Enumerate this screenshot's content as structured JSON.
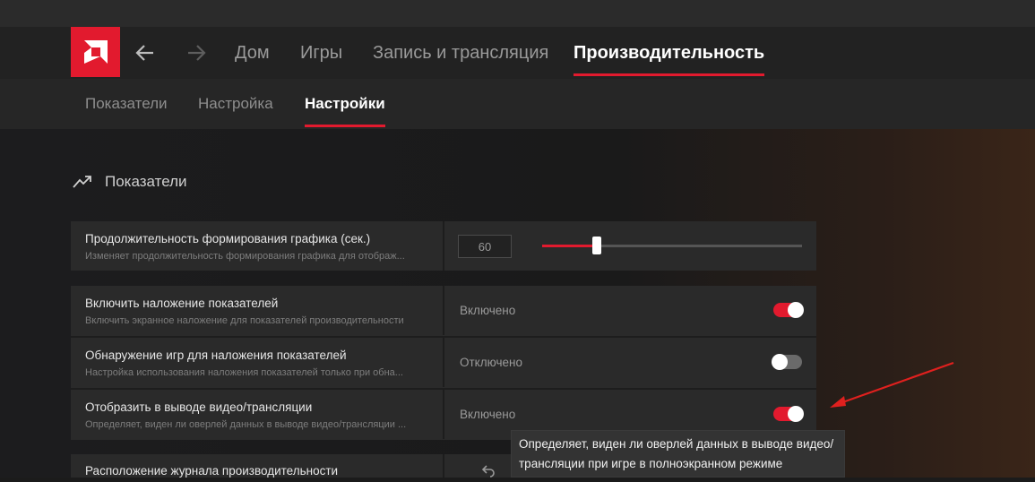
{
  "header": {
    "nav_tabs": [
      {
        "label": "Дом"
      },
      {
        "label": "Игры"
      },
      {
        "label": "Запись и трансляция"
      },
      {
        "label": "Производительность",
        "active": true
      }
    ]
  },
  "subnav": {
    "tabs": [
      {
        "label": "Показатели"
      },
      {
        "label": "Настройка"
      },
      {
        "label": "Настройки",
        "active": true
      }
    ]
  },
  "section": {
    "title": "Показатели",
    "icon": "trend-up-icon"
  },
  "graph_duration": {
    "title": "Продолжительность формирования графика (сек.)",
    "description": "Изменяет продолжительность формирования графика для отображ...",
    "value": "60",
    "slider_fraction": 0.21
  },
  "settings": [
    {
      "title": "Включить наложение показателей",
      "description": "Включить экранное наложение для показателей производительности",
      "state_label": "Включено",
      "on": true
    },
    {
      "title": "Обнаружение игр для наложения показателей",
      "description": "Настройка использования наложения показателей только при обна...",
      "state_label": "Отключено",
      "on": false
    },
    {
      "title": "Отобразить в выводе видео/трансляции",
      "description": "Определяет, виден ли оверлей данных в выводе видео/трансляции ...",
      "state_label": "Включено",
      "on": true
    }
  ],
  "log_location": {
    "title": "Расположение журнала производительности"
  },
  "tooltip": {
    "line1": "Определяет, виден ли оверлей данных в выводе видео/",
    "line2": "трансляции при игре в полноэкранном режиме"
  },
  "colors": {
    "accent": "#e21a2e",
    "background": "#1b1b1b",
    "card": "#2a2a2a"
  }
}
